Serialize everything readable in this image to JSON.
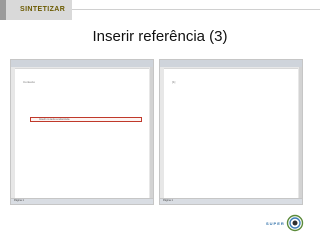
{
  "header": {
    "logo_text": "SINTETIZAR"
  },
  "slide": {
    "title": "Inserir referência (3)"
  },
  "left_window": {
    "doc_text": "Contexto",
    "highlight_text": "Inserir no texto a referência",
    "status_text": "Página 1"
  },
  "right_window": {
    "doc_text": "[1]",
    "status_text": "Página 1"
  },
  "footer": {
    "logo_text": "SUPER"
  },
  "colors": {
    "highlight_border": "#c0392b",
    "title_text": "#111111",
    "logo_text": "#6b5a00",
    "footer_text": "#2e6fa8"
  }
}
